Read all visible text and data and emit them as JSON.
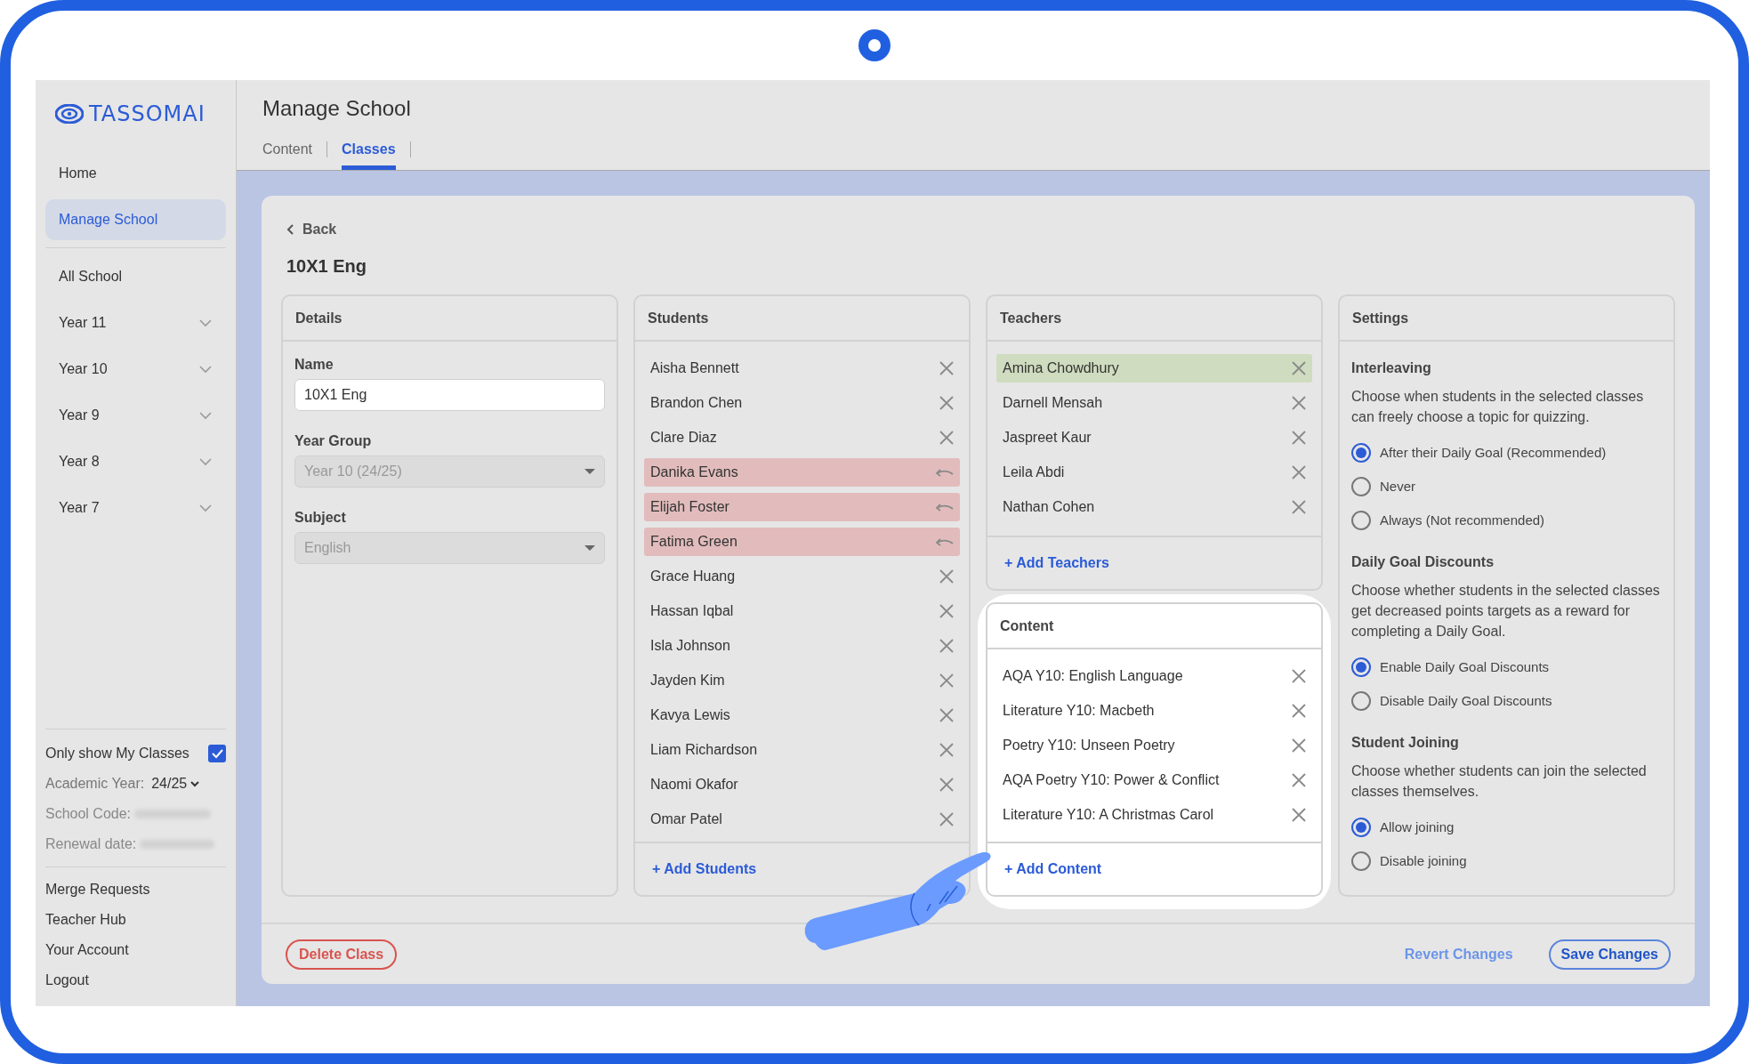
{
  "sidebar": {
    "logo": "TASSOMAI",
    "items": [
      {
        "label": "Home",
        "selected": false
      },
      {
        "label": "Manage School",
        "selected": true
      }
    ],
    "groups": [
      {
        "label": "All School",
        "expandable": false
      },
      {
        "label": "Year 11",
        "expandable": true
      },
      {
        "label": "Year 10",
        "expandable": true
      },
      {
        "label": "Year 9",
        "expandable": true
      },
      {
        "label": "Year 8",
        "expandable": true
      },
      {
        "label": "Year 7",
        "expandable": true
      }
    ],
    "filter": {
      "label": "Only show My Classes",
      "checked": true
    },
    "academic_year": {
      "label": "Academic Year:",
      "value": "24/25"
    },
    "school_code": {
      "label": "School Code:"
    },
    "renewal_date": {
      "label": "Renewal date:"
    },
    "links": [
      "Merge Requests",
      "Teacher Hub",
      "Your Account",
      "Logout"
    ]
  },
  "header": {
    "title": "Manage School",
    "tabs": [
      {
        "label": "Content",
        "selected": false
      },
      {
        "label": "Classes",
        "selected": true
      }
    ]
  },
  "back": "Back",
  "class_title": "10X1 Eng",
  "details": {
    "title": "Details",
    "fields": [
      {
        "label": "Name",
        "kind": "text",
        "value": "10X1 Eng",
        "disabled": false
      },
      {
        "label": "Year Group",
        "kind": "select",
        "value": "Year 10 (24/25)",
        "disabled": true
      },
      {
        "label": "Subject",
        "kind": "select",
        "value": "English",
        "disabled": true
      }
    ]
  },
  "students": {
    "title": "Students",
    "add": "+ Add Students",
    "items": [
      {
        "name": "Aisha Bennett",
        "removed": false
      },
      {
        "name": "Brandon Chen",
        "removed": false
      },
      {
        "name": "Clare Diaz",
        "removed": false
      },
      {
        "name": "Danika Evans",
        "removed": true
      },
      {
        "name": "Elijah Foster",
        "removed": true
      },
      {
        "name": "Fatima Green",
        "removed": true
      },
      {
        "name": "Grace Huang",
        "removed": false
      },
      {
        "name": "Hassan Iqbal",
        "removed": false
      },
      {
        "name": "Isla Johnson",
        "removed": false
      },
      {
        "name": "Jayden Kim",
        "removed": false
      },
      {
        "name": "Kavya Lewis",
        "removed": false
      },
      {
        "name": "Liam Richardson",
        "removed": false
      },
      {
        "name": "Naomi Okafor",
        "removed": false
      },
      {
        "name": "Omar Patel",
        "removed": false
      }
    ]
  },
  "teachers": {
    "title": "Teachers",
    "add": "+ Add Teachers",
    "items": [
      {
        "name": "Amina Chowdhury",
        "highlighted": true
      },
      {
        "name": "Darnell Mensah",
        "highlighted": false
      },
      {
        "name": "Jaspreet Kaur",
        "highlighted": false
      },
      {
        "name": "Leila Abdi",
        "highlighted": false
      },
      {
        "name": "Nathan Cohen",
        "highlighted": false
      }
    ]
  },
  "content": {
    "title": "Content",
    "add": "+ Add Content",
    "items": [
      "AQA Y10: English Language",
      "Literature Y10: Macbeth",
      "Poetry Y10: Unseen Poetry",
      "AQA Poetry Y10: Power & Conflict",
      "Literature Y10: A Christmas Carol"
    ]
  },
  "settings": {
    "title": "Settings",
    "sections": [
      {
        "heading": "Interleaving",
        "description": "Choose when students in the selected classes can freely choose a topic for quizzing.",
        "options": [
          {
            "label": "After their Daily Goal (Recommended)",
            "selected": true
          },
          {
            "label": "Never",
            "selected": false
          },
          {
            "label": "Always (Not recommended)",
            "selected": false
          }
        ]
      },
      {
        "heading": "Daily Goal Discounts",
        "description": "Choose whether students in the selected classes get decreased points targets as a reward for completing a Daily Goal.",
        "options": [
          {
            "label": "Enable Daily Goal Discounts",
            "selected": true
          },
          {
            "label": "Disable Daily Goal Discounts",
            "selected": false
          }
        ]
      },
      {
        "heading": "Student Joining",
        "description": "Choose whether students can join the selected classes themselves.",
        "options": [
          {
            "label": "Allow joining",
            "selected": true
          },
          {
            "label": "Disable joining",
            "selected": false
          }
        ]
      }
    ]
  },
  "footer": {
    "delete": "Delete Class",
    "revert": "Revert Changes",
    "save": "Save Changes"
  }
}
